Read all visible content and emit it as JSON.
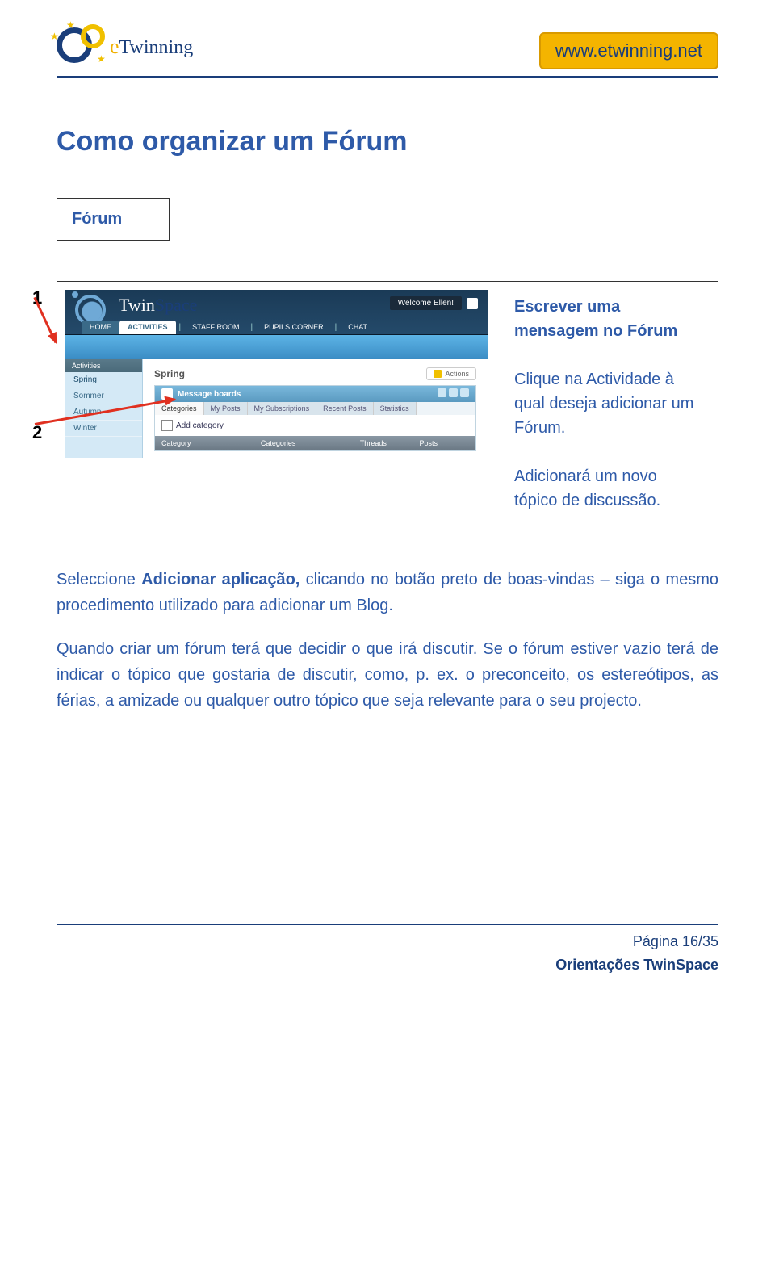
{
  "header": {
    "logo_text_prefix": "e",
    "logo_text": "Twinning",
    "url_badge": "www.etwinning.net"
  },
  "title": "Como organizar um Fórum",
  "forum_cell": "Fórum",
  "step_numbers": {
    "one": "1",
    "two": "2"
  },
  "screenshot": {
    "app_logo_twin": "Twin",
    "app_logo_space": "Space",
    "welcome": "Welcome Ellen!",
    "nav": {
      "home": "HOME",
      "activities": "ACTIVITIES",
      "staff": "STAFF ROOM",
      "pupils": "PUPILS CORNER",
      "chat": "CHAT"
    },
    "side_header": "Activities",
    "side_items": [
      "Spring",
      "Sommer",
      "Autumn",
      "Winter"
    ],
    "crumb": "Spring",
    "actions_btn": "Actions",
    "panel_title": "Message boards",
    "panel_tabs": [
      "Categories",
      "My Posts",
      "My Subscriptions",
      "Recent Posts",
      "Statistics"
    ],
    "add_category": "Add category",
    "cols": [
      "Category",
      "Categories",
      "Threads",
      "Posts"
    ]
  },
  "desc": {
    "heading": "Escrever uma mensagem no Fórum",
    "p1": "Clique na Actividade à qual deseja adicionar um Fórum.",
    "p2": "Adicionará um novo tópico de discussão."
  },
  "body": {
    "p1_a": "Seleccione ",
    "p1_b": "Adicionar aplicação,",
    "p1_c": " clicando no botão preto de boas-vindas – siga o mesmo procedimento utilizado para adicionar um Blog.",
    "p2": "Quando criar um fórum terá que decidir o que irá discutir. Se o fórum estiver vazio terá de indicar o tópico que gostaria de discutir, como, p. ex. o preconceito, os estereótipos, as férias, a amizade ou qualquer  outro tópico que seja relevante para o seu projecto."
  },
  "footer": {
    "page": "Página 16/35",
    "doc": "Orientações TwinSpace"
  }
}
